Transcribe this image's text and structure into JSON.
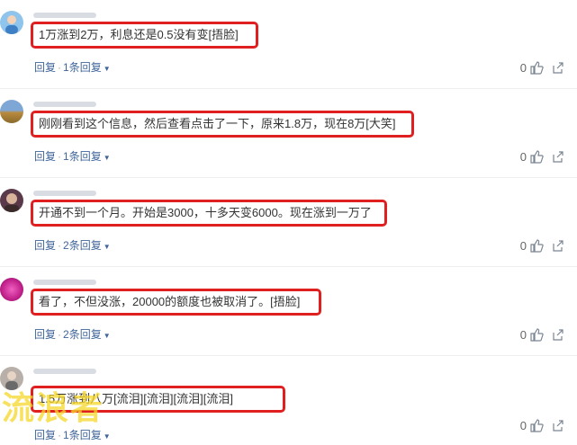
{
  "comments": [
    {
      "text": "1万涨到2万，利息还是0.5没有变[捂脸]",
      "reply_label": "回复",
      "replies_label": "1条回复",
      "likes": "0"
    },
    {
      "text": "刚刚看到这个信息，然后查看点击了一下，原来1.8万，现在8万[大笑]",
      "reply_label": "回复",
      "replies_label": "1条回复",
      "likes": "0"
    },
    {
      "text": "开通不到一个月。开始是3000，十多天变6000。现在涨到一万了",
      "reply_label": "回复",
      "replies_label": "2条回复",
      "likes": "0"
    },
    {
      "text": "看了，不但没涨，20000的额度也被取消了。[捂脸]",
      "reply_label": "回复",
      "replies_label": "2条回复",
      "likes": "0"
    },
    {
      "text": "1.5万涨到八万[流泪][流泪][流泪][流泪]",
      "reply_label": "回复",
      "replies_label": "1条回复",
      "likes": "0"
    }
  ],
  "watermark": "流浪者",
  "colors": {
    "highlight_border": "#e02020",
    "link": "#406599",
    "text": "#333333"
  }
}
